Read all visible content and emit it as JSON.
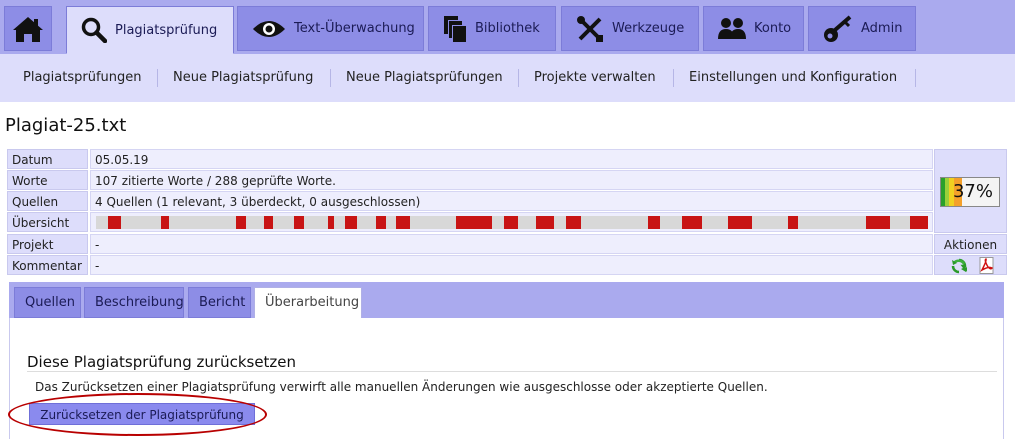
{
  "nav": {
    "tabs": [
      {
        "label": "Plagiatsprüfung",
        "icon": "magnifier-icon"
      },
      {
        "label": "Text-Überwachung",
        "icon": "eye-icon"
      },
      {
        "label": "Bibliothek",
        "icon": "documents-icon"
      },
      {
        "label": "Werkzeuge",
        "icon": "tools-icon"
      },
      {
        "label": "Konto",
        "icon": "users-icon"
      },
      {
        "label": "Admin",
        "icon": "key-icon"
      }
    ],
    "active_tab": "Plagiatsprüfung",
    "subnav": [
      "Plagiatsprüfungen",
      "Neue Plagiatsprüfung",
      "Neue Plagiatsprüfungen",
      "Projekte verwalten",
      "Einstellungen und Konfiguration"
    ]
  },
  "page": {
    "title": "Plagiat-25.txt"
  },
  "info": {
    "datum_label": "Datum",
    "datum": "05.05.19",
    "worte_label": "Worte",
    "worte": "107 zitierte Worte / 288 geprüfte Worte.",
    "quellen_label": "Quellen",
    "quellen": "4 Quellen (1 relevant, 3 überdeckt, 0 ausgeschlossen)",
    "uebersicht_label": "Übersicht",
    "projekt_label": "Projekt",
    "projekt": "-",
    "kommentar_label": "Kommentar",
    "kommentar": "-",
    "aktionen_label": "Aktionen",
    "score": "37%",
    "score_value": 0.37,
    "action_icons": [
      "refresh-icon",
      "pdf-icon"
    ]
  },
  "panel": {
    "tabs": [
      "Quellen",
      "Beschreibung",
      "Bericht",
      "Überarbeitung"
    ],
    "active_tab": "Überarbeitung",
    "section_title": "Diese Plagiatsprüfung zurücksetzen",
    "section_desc": "Das Zurücksetzen einer Plagiatsprüfung verwirft alle manuellen Änderungen wie ausgeschlosse oder akzeptierte Quellen.",
    "reset_button": "Zurücksetzen der Plagiatsprüfung"
  },
  "colors": {
    "nav_bg": "#aaaaee",
    "tab_bg": "#8d8de6",
    "subnav_bg": "#ddddfb",
    "match_red": "#c81414",
    "highlight": "#b80000"
  }
}
